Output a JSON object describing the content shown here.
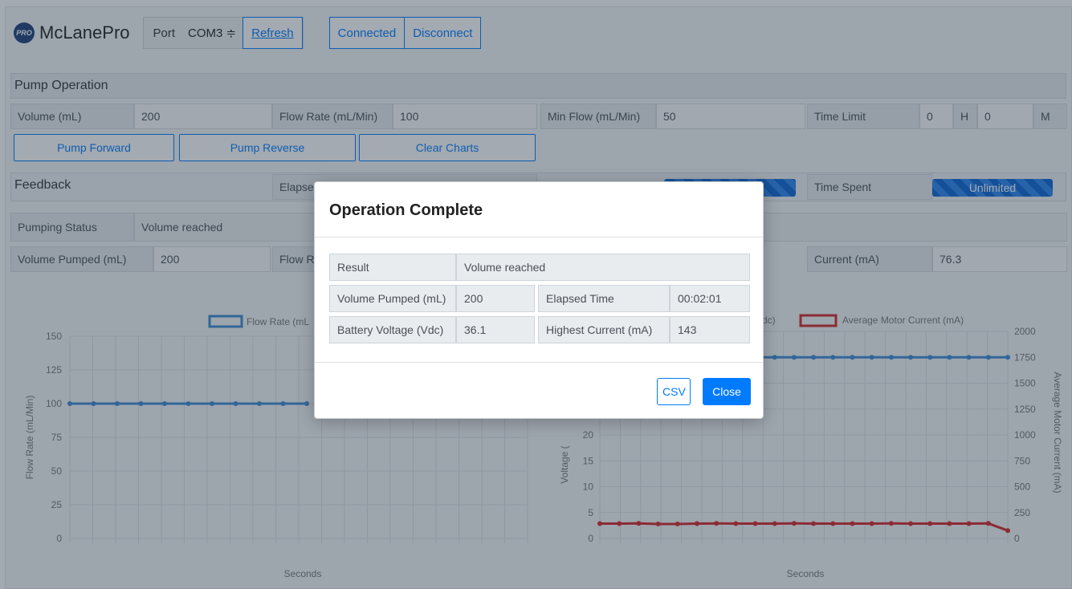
{
  "header": {
    "logo_badge": "PRO",
    "app_name": "McLanePro",
    "port_label": "Port",
    "port_value": "COM3 ≑",
    "refresh_label": "Refresh",
    "connected_label": "Connected",
    "disconnect_label": "Disconnect"
  },
  "pump_operation": {
    "title": "Pump Operation",
    "volume_label": "Volume (mL)",
    "volume_value": "200",
    "flow_rate_label": "Flow Rate (mL/Min)",
    "flow_rate_value": "100",
    "min_flow_label": "Min Flow (mL/Min)",
    "min_flow_value": "50",
    "time_limit_label": "Time Limit",
    "time_limit_hours": "0",
    "hours_unit": "H",
    "time_limit_minutes": "0",
    "minutes_unit": "M",
    "pump_forward_label": "Pump Forward",
    "pump_reverse_label": "Pump Reverse",
    "clear_charts_label": "Clear Charts"
  },
  "feedback": {
    "title": "Feedback",
    "elapsed_label": "Elapse",
    "time_spent_label": "Time Spent",
    "time_spent_value": "Unlimited",
    "pumping_status_label": "Pumping Status",
    "pumping_status_value": "Volume reached",
    "volume_pumped_label": "Volume Pumped (mL)",
    "volume_pumped_value": "200",
    "flow_partial_label": "Flow R",
    "current_label": "Current (mA)",
    "current_value": "76.3"
  },
  "chart_data": [
    {
      "type": "line",
      "legend": [
        "Flow Rate (mL"
      ],
      "xlabel": "Seconds",
      "ylabel": "Flow Rate (mL/Min)",
      "ylim": [
        0,
        150
      ],
      "yticks": [
        0,
        25,
        50,
        75,
        100,
        125,
        150
      ],
      "series": [
        {
          "name": "Flow Rate (mL",
          "color": "#3d8bd4",
          "values": [
            100,
            100,
            100,
            100,
            100,
            100,
            100,
            100,
            100,
            100,
            100
          ]
        }
      ]
    },
    {
      "type": "line",
      "legend": [
        "Vdc)",
        "Average Motor Current (mA)"
      ],
      "xlabel": "Seconds",
      "ylabel_left": "Voltage (",
      "ylabel_right": "Average Motor Current (mA)",
      "yticks_left": [
        0,
        5,
        10,
        15,
        20
      ],
      "ylim_right": [
        0,
        2000
      ],
      "yticks_right": [
        0,
        250,
        500,
        750,
        1000,
        1250,
        1500,
        1750,
        2000
      ],
      "series": [
        {
          "name": "Vdc)",
          "color": "#3d8bd4",
          "axis": "left",
          "values": [
            36,
            36,
            36,
            36,
            36,
            36,
            36,
            36,
            36,
            36,
            36,
            36,
            36,
            36,
            36,
            36,
            36,
            36,
            36,
            36,
            36,
            36
          ]
        },
        {
          "name": "Average Motor Current (mA)",
          "color": "#d62728",
          "axis": "right",
          "values": [
            143,
            143,
            145,
            140,
            140,
            143,
            145,
            143,
            143,
            143,
            145,
            143,
            143,
            143,
            143,
            145,
            143,
            143,
            143,
            143,
            145,
            76
          ]
        }
      ]
    }
  ],
  "modal": {
    "title": "Operation Complete",
    "result_label": "Result",
    "result_value": "Volume reached",
    "volume_pumped_label": "Volume Pumped (mL)",
    "volume_pumped_value": "200",
    "elapsed_time_label": "Elapsed Time",
    "elapsed_time_value": "00:02:01",
    "battery_voltage_label": "Battery Voltage (Vdc)",
    "battery_voltage_value": "36.1",
    "highest_current_label": "Highest Current (mA)",
    "highest_current_value": "143",
    "csv_label": "CSV",
    "close_label": "Close"
  },
  "colors": {
    "primary": "#007bff",
    "flow_series": "#3d8bd4",
    "current_series": "#d62728",
    "backdrop": "rgba(36,52,68,0.42)"
  }
}
